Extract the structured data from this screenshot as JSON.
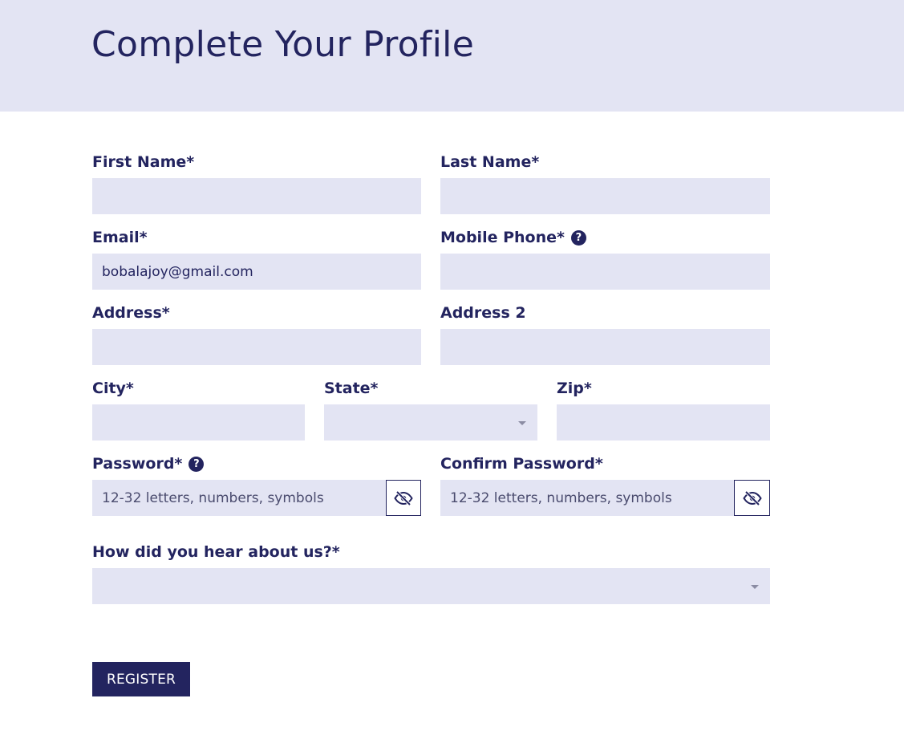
{
  "header": {
    "title": "Complete Your Profile"
  },
  "form": {
    "first_name": {
      "label": "First Name*",
      "value": ""
    },
    "last_name": {
      "label": "Last Name*",
      "value": ""
    },
    "email": {
      "label": "Email*",
      "value": "bobalajoy@gmail.com"
    },
    "mobile_phone": {
      "label": "Mobile Phone*",
      "value": "",
      "help": "?"
    },
    "address": {
      "label": "Address*",
      "value": ""
    },
    "address2": {
      "label": "Address 2",
      "value": ""
    },
    "city": {
      "label": "City*",
      "value": ""
    },
    "state": {
      "label": "State*",
      "value": ""
    },
    "zip": {
      "label": "Zip*",
      "value": ""
    },
    "password": {
      "label": "Password*",
      "placeholder": "12-32 letters, numbers, symbols",
      "help": "?"
    },
    "confirm_password": {
      "label": "Confirm Password*",
      "placeholder": "12-32 letters, numbers, symbols"
    },
    "referral": {
      "label": "How did you hear about us?*",
      "value": ""
    },
    "register_label": "REGISTER"
  },
  "icons": {
    "help": "question-circle-icon",
    "eye": "eye-slash-icon",
    "caret": "caret-down-icon"
  },
  "colors": {
    "primary": "#23245f",
    "field_bg": "#e3e4f3",
    "header_bg": "#e3e4f3"
  }
}
